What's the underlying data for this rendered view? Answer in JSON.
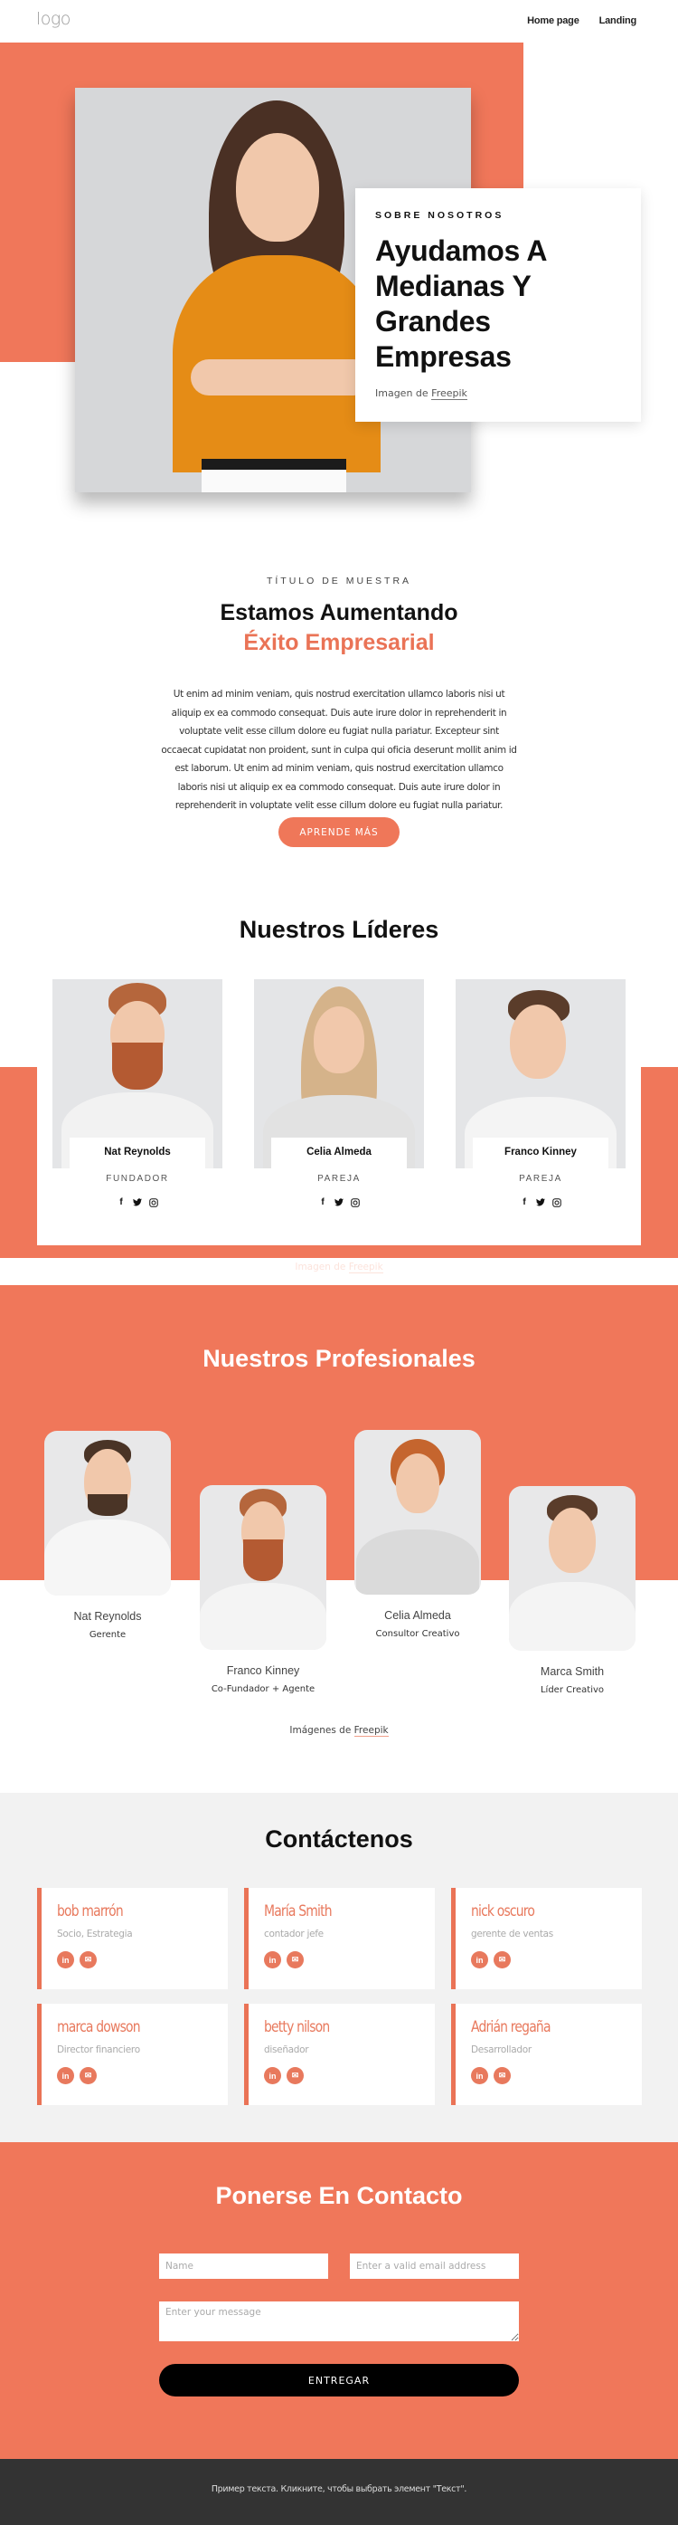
{
  "header": {
    "logo": "logo",
    "nav": [
      {
        "label": "Home page"
      },
      {
        "label": "Landing"
      }
    ]
  },
  "hero": {
    "eyebrow": "SOBRE NOSOTROS",
    "title": "Ayudamos A Medianas Y Grandes Empresas",
    "credit_prefix": "Imagen de",
    "credit_link": "Freepik"
  },
  "about": {
    "eyebrow": "TÍTULO DE MUESTRA",
    "title_line1": "Estamos Aumentando",
    "title_line2": "Éxito Empresarial",
    "body": "Ut enim ad minim veniam, quis nostrud exercitation ullamco laboris nisi ut aliquip ex ea commodo consequat. Duis aute irure dolor in reprehenderit in voluptate velit esse cillum dolore eu fugiat nulla pariatur. Excepteur sint occaecat cupidatat non proident, sunt in culpa qui oficia deserunt mollit anim id est laborum. Ut enim ad minim veniam, quis nostrud exercitation ullamco laboris nisi ut aliquip ex ea commodo consequat. Duis aute irure dolor in reprehenderit in voluptate velit esse cillum dolore eu fugiat nulla pariatur.",
    "button": "APRENDE MÁS"
  },
  "leaders": {
    "title": "Nuestros Líderes",
    "items": [
      {
        "name": "Nat Reynolds",
        "role": "FUNDADOR"
      },
      {
        "name": "Celia Almeda",
        "role": "PAREJA"
      },
      {
        "name": "Franco Kinney",
        "role": "PAREJA"
      }
    ],
    "socials": [
      "facebook-icon",
      "twitter-icon",
      "instagram-icon"
    ],
    "credit_prefix": "Imagen de",
    "credit_link": "Freepik"
  },
  "professionals": {
    "title": "Nuestros Profesionales",
    "items": [
      {
        "name": "Nat Reynolds",
        "role": "Gerente"
      },
      {
        "name": "Franco Kinney",
        "role": "Co-Fundador + Agente"
      },
      {
        "name": "Celia Almeda",
        "role": "Consultor Creativo"
      },
      {
        "name": "Marca Smith",
        "role": "Líder Creativo"
      }
    ],
    "credit_prefix": "Imágenes de",
    "credit_link": "Freepik"
  },
  "contacts": {
    "title": "Contáctenos",
    "items": [
      {
        "name": "bob marrón",
        "role": "Socio, Estrategia"
      },
      {
        "name": "María Smith",
        "role": "contador jefe"
      },
      {
        "name": "nick oscuro",
        "role": "gerente de ventas"
      },
      {
        "name": "marca dowson",
        "role": "Director financiero"
      },
      {
        "name": "betty nilson",
        "role": "diseñador"
      },
      {
        "name": "Adrián regaña",
        "role": "Desarrollador"
      }
    ]
  },
  "form": {
    "title": "Ponerse En Contacto",
    "name_placeholder": "Name",
    "email_placeholder": "Enter a valid email address",
    "message_placeholder": "Enter your message",
    "submit": "ENTREGAR"
  },
  "footer": {
    "text": "Пример текста. Кликните, чтобы выбрать элемент \"Текст\"."
  },
  "colors": {
    "accent": "#f0775a",
    "accent_text": "#ea7356",
    "footer_bg": "#333333",
    "contact_bg": "#f2f2f2"
  }
}
